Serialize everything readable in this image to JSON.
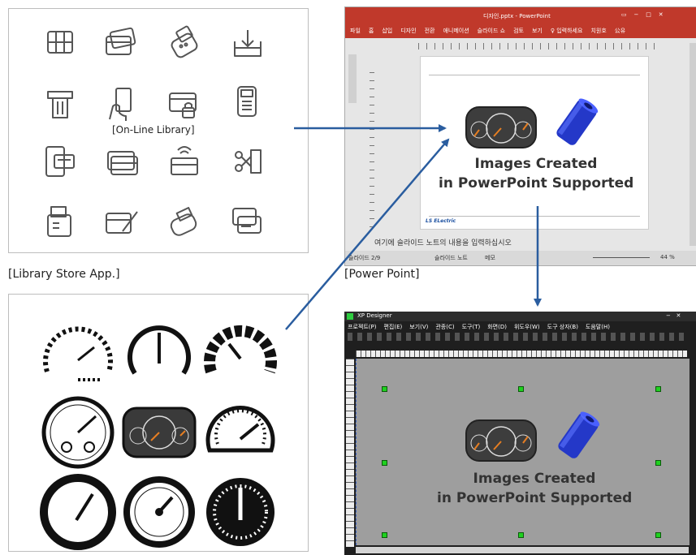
{
  "library_panel": {
    "label": "[On-Line Library]",
    "caption": "[Library Store App.]"
  },
  "powerpoint_panel": {
    "caption": "[Power Point]",
    "window_title": "디자인.pptx - PowerPoint",
    "ribbon_tabs": [
      "파일",
      "홈",
      "삽입",
      "디자인",
      "전환",
      "애니메이션",
      "슬라이드 쇼",
      "검토",
      "보기",
      "♀ 입력하세요",
      "치원호",
      "公유"
    ],
    "status_left": "슬라이드 2/9",
    "status_notes": "슬라이드 노트",
    "status_memo": "메모",
    "zoom": "44 %",
    "notes_placeholder": "여기에 슬라이드 노트의 내용을 입력하십시오",
    "footer_logo": "LS ELectric",
    "overlay_text_line1": "Images Created",
    "overlay_text_line2": "in PowerPoint Supported"
  },
  "xp_panel": {
    "window_title": "XP Designer",
    "menu_items": [
      "프로젝트(P)",
      "편집(E)",
      "보기(V)",
      "관종(C)",
      "도구(T)",
      "화면(D)",
      "위도우(W)",
      "도구 상자(B)",
      "도움말(H)"
    ],
    "overlay_text_line1": "Images Created",
    "overlay_text_line2": "in PowerPoint Supported"
  },
  "colors": {
    "ppt_red": "#c0392b",
    "arrow_blue": "#2a5d9f",
    "xp_gray": "#9e9e9e",
    "xp_dark": "#1f1f1f",
    "cylinder_blue": "#2438c8"
  }
}
